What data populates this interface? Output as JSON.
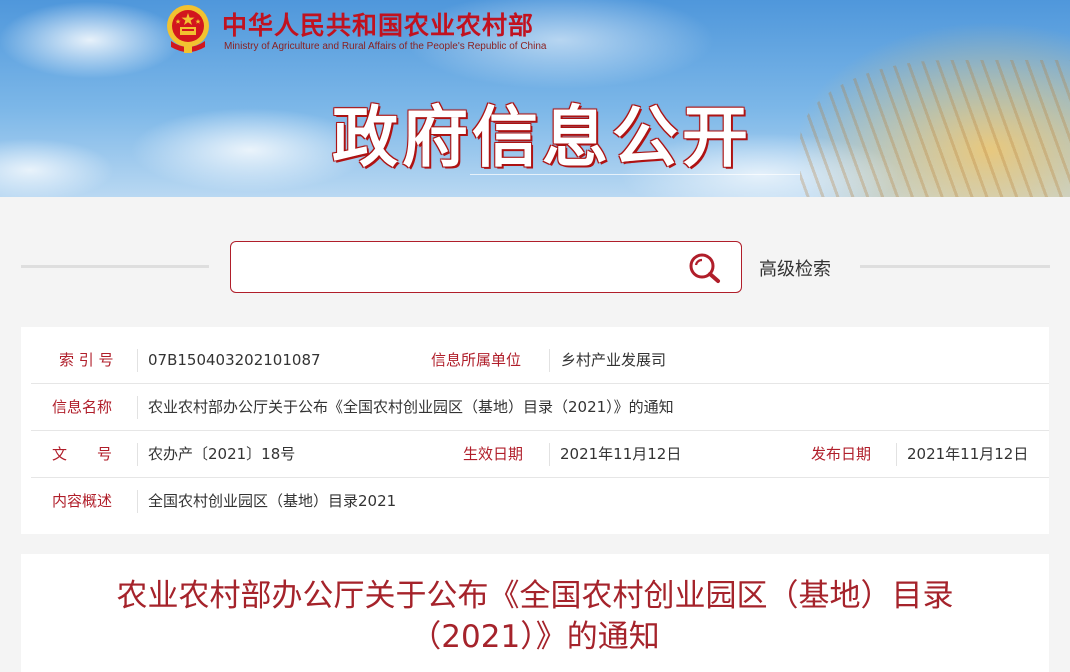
{
  "header": {
    "ministry_name_cn": "中华人民共和国农业农村部",
    "ministry_name_en": "Ministry of Agriculture and Rural Affairs of the People's Republic of China",
    "banner_title": "政府信息公开",
    "emblem_icon": "national-emblem-icon"
  },
  "search": {
    "placeholder": "",
    "value": "",
    "advanced_label": "高级检索",
    "icon": "search-icon",
    "border_color": "#b01e2a"
  },
  "info": {
    "index_label": "索 引 号",
    "index_value": "07B150403202101087",
    "unit_label": "信息所属单位",
    "unit_value": "乡村产业发展司",
    "name_label": "信息名称",
    "name_value": "农业农村部办公厅关于公布《全国农村创业园区（基地）目录（2021）》的通知",
    "doc_no_label": "文　　号",
    "doc_no_value": "农办产〔2021〕18号",
    "effective_label": "生效日期",
    "effective_value": "2021年11月12日",
    "publish_label": "发布日期",
    "publish_value": "2021年11月12日",
    "summary_label": "内容概述",
    "summary_value": "全国农村创业园区（基地）目录2021"
  },
  "article": {
    "title_line1": "农业农村部办公厅关于公布《全国农村创业园区（基地）目录",
    "title_line2": "（2021）》的通知"
  },
  "colors": {
    "accent": "#b01e2a",
    "title": "#a5232b",
    "emblem_red": "#d2161e",
    "emblem_gold": "#f2c230"
  }
}
